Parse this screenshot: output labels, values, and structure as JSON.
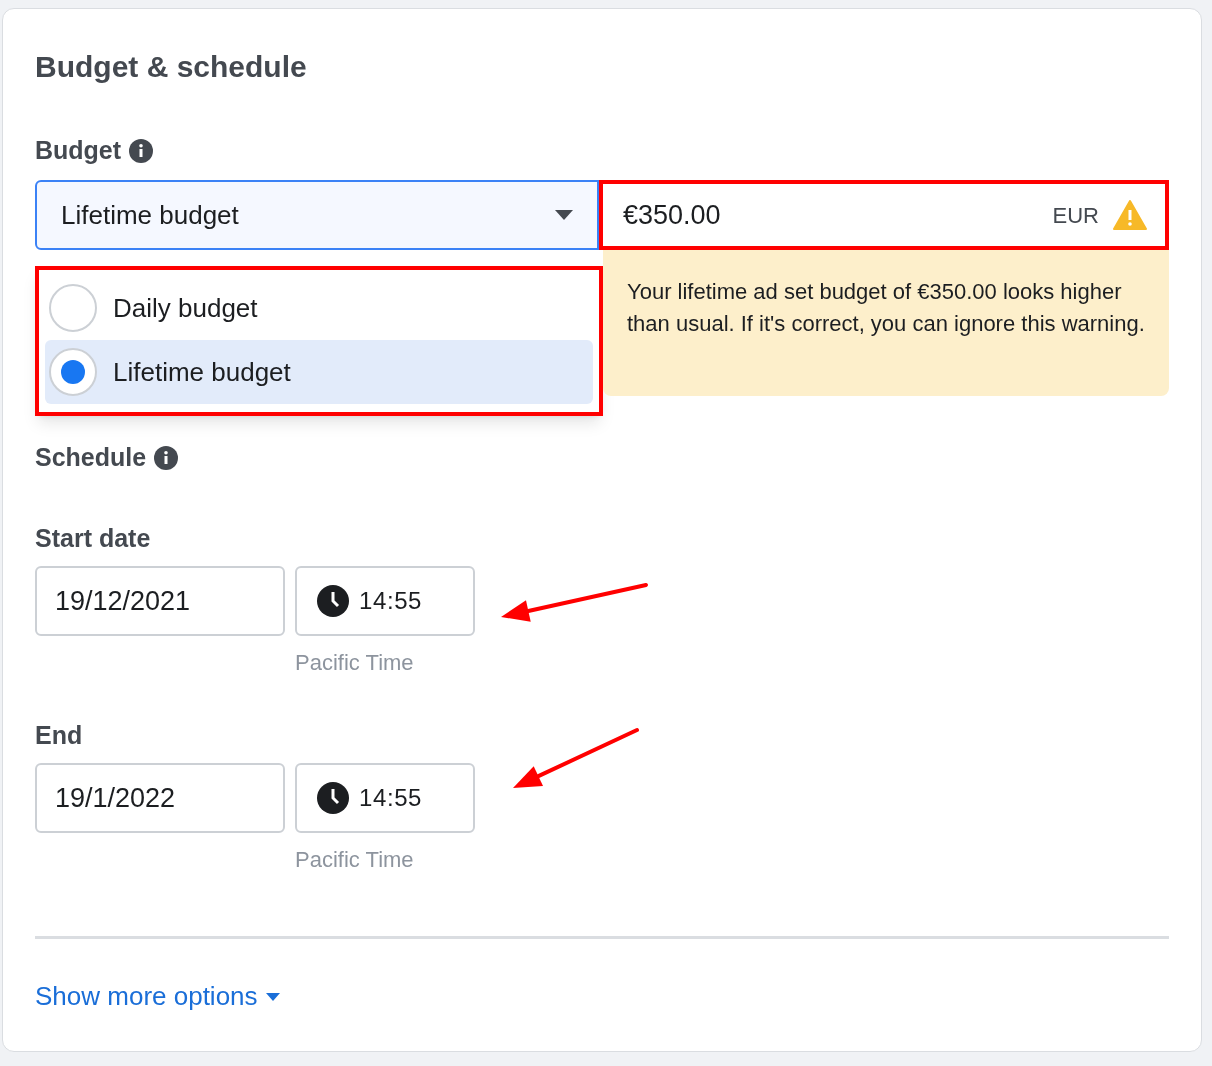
{
  "title": "Budget & schedule",
  "budget": {
    "label": "Budget",
    "select_value": "Lifetime budget",
    "amount": "€350.00",
    "currency": "EUR",
    "options": [
      {
        "label": "Daily budget",
        "selected": false
      },
      {
        "label": "Lifetime budget",
        "selected": true
      }
    ],
    "warning": "Your lifetime ad set budget of €350.00 looks higher than usual. If it's correct, you can ignore this warning."
  },
  "schedule": {
    "label": "Schedule",
    "fields": [
      {
        "label": "Start date",
        "date": "19/12/2021",
        "time": "14:55",
        "timezone": "Pacific Time"
      },
      {
        "label": "End",
        "date": "19/1/2022",
        "time": "14:55",
        "timezone": "Pacific Time"
      }
    ]
  },
  "footer_link": "Show more options"
}
